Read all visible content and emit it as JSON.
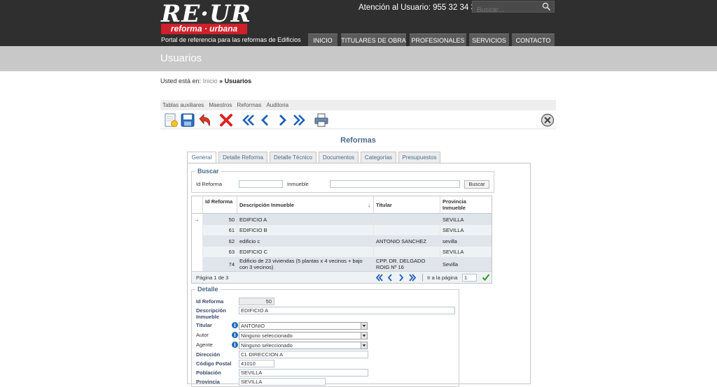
{
  "header": {
    "logo_main": "RE·UR",
    "logo_sub": "reforma · urbana",
    "tagline": "Portal de referencia para las reformas de Edificios",
    "phone": "Atención al Usuario: 955 32 34 31",
    "search_placeholder": "Buscar...",
    "nav": [
      "INICIO",
      "TITULARES DE OBRA",
      "PROFESIONALES",
      "SERVICIOS",
      "CONTACTO"
    ]
  },
  "page": {
    "title": "Usuarios",
    "breadcrumb_prefix": "Usted está en:",
    "breadcrumb_link": "Inicio",
    "breadcrumb_sep": "»",
    "breadcrumb_current": "Usuarios"
  },
  "menu": [
    "Tablas auxiliares",
    "Maestros",
    "Reformas",
    "Auditoria"
  ],
  "toolbar": {
    "icons": [
      "new-record-icon",
      "save-icon",
      "undo-icon",
      "delete-icon",
      "first-record-icon",
      "previous-record-icon",
      "next-record-icon",
      "last-record-icon",
      "print-icon",
      "close-icon"
    ]
  },
  "form": {
    "title": "Reformas",
    "tabs": [
      "General",
      "Detalle Reforma",
      "Detalle Técnico",
      "Documentos",
      "Categorías",
      "Presupuestos"
    ],
    "search": {
      "legend": "Buscar",
      "id_label": "Id Reforma",
      "id_value": "",
      "inmueble_label": "Inmueble",
      "inmueble_value": "",
      "button": "Buscar"
    },
    "grid": {
      "headers": [
        "Id Reforma",
        "Descripción Inmueble",
        "Titular",
        "Provincia Inmueble"
      ],
      "sort_indicator": "↓",
      "rows": [
        {
          "marker": "→",
          "id": "50",
          "desc": "EDIFICIO A",
          "titular": "",
          "provincia": "SEVILLA"
        },
        {
          "marker": "",
          "id": "61",
          "desc": "EDIFICIO B",
          "titular": "",
          "provincia": "SEVILLA"
        },
        {
          "marker": "",
          "id": "62",
          "desc": "edificio c",
          "titular": "ANTONIO SANCHEZ",
          "provincia": "sevilla"
        },
        {
          "marker": "",
          "id": "63",
          "desc": "EDIFICIO C",
          "titular": "",
          "provincia": "SEVILLA"
        },
        {
          "marker": "",
          "id": "74",
          "desc": "Edificio de 23 viviendas (5 plantas x 4 vecinos + bajo con 3 vecinos)",
          "titular": "CPP. DR. DELGADO ROIG Nº 16",
          "provincia": "Sevilla"
        }
      ],
      "page_info": "Página 1 de 3",
      "goto_label": "Ir a la página",
      "goto_value": "1"
    },
    "detail": {
      "legend": "Detalle",
      "id_label": "Id Reforma",
      "id_value": "50",
      "desc_label": "Descripción Inmueble",
      "desc_value": "EDIFICIO A",
      "titular_label": "Titular",
      "titular_value": "ANTONIO",
      "autor_label": "Autor",
      "autor_value": "Ninguno seleccionado",
      "agente_label": "Agente",
      "agente_value": "Ninguno seleccionado",
      "direccion_label": "Dirección",
      "direccion_value": "CL DIRECCION A",
      "cp_label": "Código Postal",
      "cp_value": "41010",
      "poblacion_label": "Población",
      "poblacion_value": "SEVILLA",
      "provincia_label": "Provincia",
      "provincia_value": "SEVILLA"
    }
  }
}
